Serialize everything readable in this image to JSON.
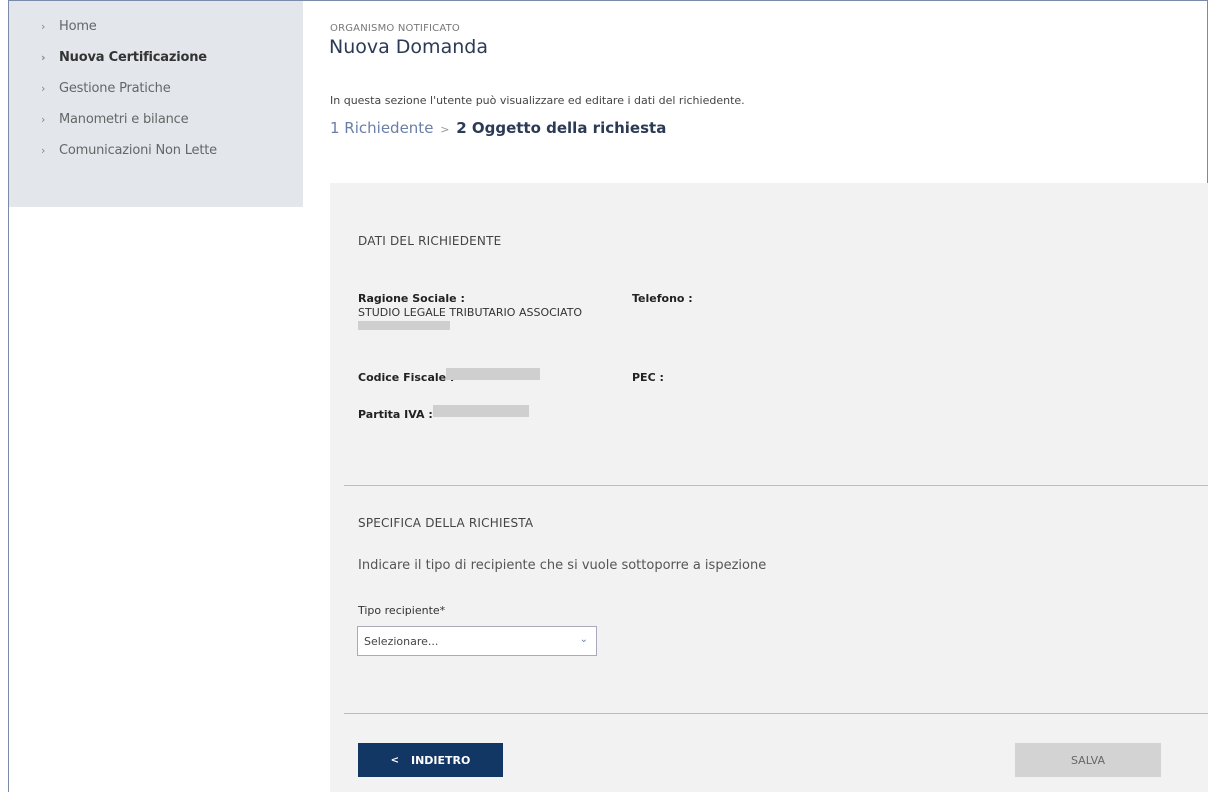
{
  "sidebar": {
    "items": [
      {
        "label": "Home"
      },
      {
        "label": "Nuova Certificazione"
      },
      {
        "label": "Gestione Pratiche"
      },
      {
        "label": "Manometri e bilance"
      },
      {
        "label": "Comunicazioni Non Lette"
      }
    ],
    "active_index": 1
  },
  "header": {
    "org": "ORGANISMO NOTIFICATO",
    "title": "Nuova Domanda",
    "description": "In questa sezione l'utente può visualizzare ed editare i dati del richiedente."
  },
  "steps": {
    "step1": "1 Richiedente",
    "separator": ">",
    "step2": "2 Oggetto della richiesta"
  },
  "richiedente": {
    "section_title": "DATI DEL RICHIEDENTE",
    "ragione_sociale_label": "Ragione Sociale :",
    "ragione_sociale_value": "STUDIO LEGALE TRIBUTARIO ASSOCIATO",
    "telefono_label": "Telefono :",
    "codice_fiscale_label": "Codice Fiscale :",
    "pec_label": "PEC :",
    "partita_iva_label": "Partita IVA :"
  },
  "specifica": {
    "section_title": "SPECIFICA DELLA RICHIESTA",
    "hint": "Indicare il tipo di recipiente che si vuole sottoporre a ispezione",
    "tipo_label": "Tipo recipiente*",
    "tipo_value": "Selezionare..."
  },
  "actions": {
    "back_label": "INDIETRO",
    "save_label": "SALVA"
  },
  "icons": {
    "sidebar_chevron": "chevron-right-icon",
    "back_chevron": "chevron-left-icon",
    "select_arrow": "chevron-down-icon"
  },
  "colors": {
    "primary": "#133764",
    "sidebar_bg": "#e3e7ec",
    "panel_bg": "#f2f2f2",
    "save_disabled": "#d3d3d3"
  }
}
